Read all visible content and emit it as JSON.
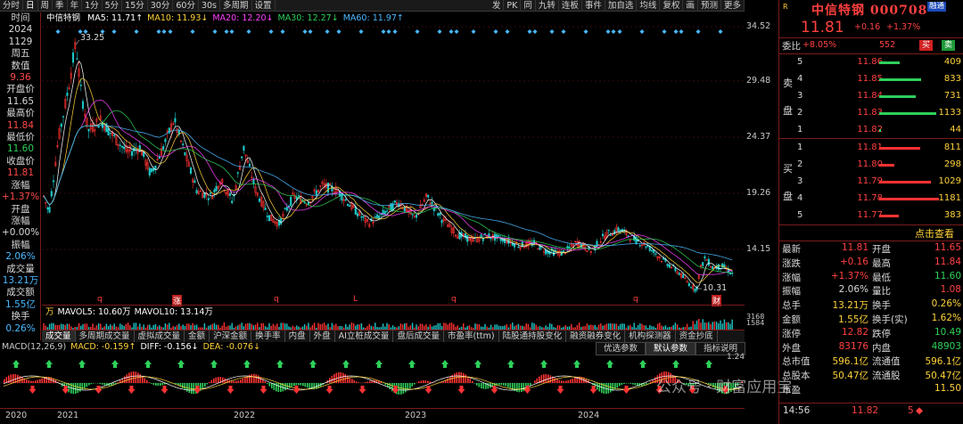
{
  "toolbar": {
    "left_items": [
      "分时",
      "日",
      "周",
      "季",
      "年",
      "1分",
      "5分",
      "15分",
      "30分",
      "60分",
      "30s",
      "多周期",
      "设置"
    ],
    "right_items": [
      "发",
      "PK",
      "同",
      "九转",
      "连板",
      "事件",
      "加自选",
      "均线",
      "复权",
      "画",
      "预测",
      "更多"
    ]
  },
  "left_panel": [
    {
      "text": "时间",
      "tone": "w"
    },
    {
      "text": "2024",
      "tone": "w"
    },
    {
      "text": "1129",
      "tone": "w"
    },
    {
      "text": "周五",
      "tone": "w"
    },
    {
      "text": "数值",
      "tone": "w"
    },
    {
      "text": "9.36",
      "tone": "r"
    },
    {
      "text": "开盘价",
      "tone": "w"
    },
    {
      "text": "11.65",
      "tone": "w"
    },
    {
      "text": "最高价",
      "tone": "w"
    },
    {
      "text": "11.84",
      "tone": "r"
    },
    {
      "text": "最低价",
      "tone": "w"
    },
    {
      "text": "11.60",
      "tone": "g"
    },
    {
      "text": "收盘价",
      "tone": "w"
    },
    {
      "text": "11.81",
      "tone": "r"
    },
    {
      "text": "涨幅",
      "tone": "w"
    },
    {
      "text": "+1.37%",
      "tone": "r"
    },
    {
      "text": "开盘",
      "tone": "w"
    },
    {
      "text": "涨幅",
      "tone": "w"
    },
    {
      "text": "+0.00%",
      "tone": "w"
    },
    {
      "text": "振幅",
      "tone": "w"
    },
    {
      "text": "2.06%",
      "tone": "c"
    },
    {
      "text": "成交量",
      "tone": "w"
    },
    {
      "text": "13.21万",
      "tone": "c"
    },
    {
      "text": "成交额",
      "tone": "w"
    },
    {
      "text": "1.55亿",
      "tone": "c"
    },
    {
      "text": "换手",
      "tone": "w"
    },
    {
      "text": "0.26%",
      "tone": "c"
    }
  ],
  "main_chart": {
    "stock_name": "中信特钢",
    "ma_legend": [
      {
        "label": "MA5: 11.71↑",
        "color": "#ffffff"
      },
      {
        "label": "MA10: 11.93↓",
        "color": "#ffd23a"
      },
      {
        "label": "MA20: 12.20↓",
        "color": "#ff40ff"
      },
      {
        "label": "MA30: 12.27↓",
        "color": "#2ed05a"
      },
      {
        "label": "MA60: 11.97↑",
        "color": "#4ab8ff"
      }
    ],
    "peak_label": "33.25",
    "low_label": "10.31",
    "markers": [
      "q",
      "涨",
      "q",
      "L",
      "q",
      "q",
      "财"
    ]
  },
  "price_axis": [
    "34.52",
    "29.48",
    "24.37",
    "19.26",
    "14.15"
  ],
  "volume": {
    "legend": [
      {
        "label": "万",
        "color": "#ffd23a"
      },
      {
        "label": "MAVOL5: 10.60万",
        "color": "#ffffff"
      },
      {
        "label": "MAVOL10: 13.14万",
        "color": "#ffffff"
      }
    ],
    "axis_labels": [
      "3168",
      "1584"
    ]
  },
  "indicator_tabs": [
    "成交量",
    "多周期成交量",
    "虚拟成交量",
    "金额",
    "沪深金额",
    "换手率",
    "内盘",
    "外盘",
    "AI立桩成交量",
    "盘后成交量",
    "市盈率(ttm)",
    "陆股通持股变化",
    "融资融券变化",
    "机构探测器",
    "资金抄底"
  ],
  "sub_tabs": [
    "优选参数",
    "默认参数",
    "指标说明"
  ],
  "macd": {
    "legend": [
      {
        "label": "MACD(12,26,9)",
        "color": "#c8c8c8"
      },
      {
        "label": "MACD: -0.159↑",
        "color": "#ffd23a"
      },
      {
        "label": "DIFF: -0.156↓",
        "color": "#ffffff"
      },
      {
        "label": "DEA: -0.076↓",
        "color": "#ffd23a"
      }
    ],
    "axis_label": "1.24"
  },
  "x_axis": [
    "2020",
    "2021",
    "2022",
    "2023",
    "2024"
  ],
  "quote": {
    "market": "R",
    "name": "中信特钢",
    "code": "000708",
    "badge": "融通",
    "price": "11.81",
    "change": "+0.16",
    "change_pct": "+1.37%",
    "wei_bi_label": "委比",
    "wei_bi": "+8.05%",
    "wei_cha": "552",
    "buy_btn": "买",
    "sell_btn": "卖",
    "sell_side_label": [
      "卖",
      "盘"
    ],
    "buy_side_label": [
      "买",
      "盘"
    ],
    "asks": [
      {
        "level": "5",
        "price": "11.86",
        "volume": "409"
      },
      {
        "level": "4",
        "price": "11.85",
        "volume": "833"
      },
      {
        "level": "3",
        "price": "11.84",
        "volume": "731"
      },
      {
        "level": "2",
        "price": "11.83",
        "volume": "1133"
      },
      {
        "level": "1",
        "price": "11.82",
        "volume": "44"
      }
    ],
    "bids": [
      {
        "level": "1",
        "price": "11.81",
        "volume": "811"
      },
      {
        "level": "2",
        "price": "11.80",
        "volume": "298"
      },
      {
        "level": "3",
        "price": "11.79",
        "volume": "1029"
      },
      {
        "level": "4",
        "price": "11.78",
        "volume": "1181"
      },
      {
        "level": "5",
        "price": "11.77",
        "volume": "383"
      }
    ],
    "detail_link": "点击查看",
    "stats": [
      {
        "l1": "最新",
        "v1": "11.81",
        "c1": "r",
        "l2": "开盘",
        "v2": "11.65",
        "c2": "r"
      },
      {
        "l1": "涨跌",
        "v1": "+0.16",
        "c1": "r",
        "l2": "最高",
        "v2": "11.84",
        "c2": "r"
      },
      {
        "l1": "涨幅",
        "v1": "+1.37%",
        "c1": "r",
        "l2": "最低",
        "v2": "11.60",
        "c2": "g"
      },
      {
        "l1": "振幅",
        "v1": "2.06%",
        "c1": "w",
        "l2": "量比",
        "v2": "1.08",
        "c2": "r"
      },
      {
        "l1": "总手",
        "v1": "13.21万",
        "c1": "y",
        "l2": "换手",
        "v2": "0.26%",
        "c2": "y"
      },
      {
        "l1": "金额",
        "v1": "1.55亿",
        "c1": "y",
        "l2": "换手(实)",
        "v2": "1.62%",
        "c2": "y"
      },
      {
        "l1": "涨停",
        "v1": "12.82",
        "c1": "r",
        "l2": "跌停",
        "v2": "10.49",
        "c2": "g"
      },
      {
        "l1": "外盘",
        "v1": "83176",
        "c1": "r",
        "l2": "内盘",
        "v2": "48903",
        "c2": "g"
      },
      {
        "l1": "总市值",
        "v1": "596.1亿",
        "c1": "y",
        "l2": "流通值",
        "v2": "596.1亿",
        "c2": "y"
      },
      {
        "l1": "总股本",
        "v1": "50.47亿",
        "c1": "y",
        "l2": "流通股",
        "v2": "50.47亿",
        "c2": "y"
      },
      {
        "l1": "市盈",
        "v1": "",
        "c1": "y",
        "l2": "",
        "v2": "11.50",
        "c2": "y"
      }
    ],
    "last_trade": {
      "time": "14:56",
      "price": "11.82",
      "volume": "5"
    }
  },
  "watermark": "公众号 · 财富应用宝",
  "colors": {
    "up": "#ff3232",
    "down": "#1ec8c8",
    "bg": "#000000",
    "frame": "#7a1a1a"
  }
}
